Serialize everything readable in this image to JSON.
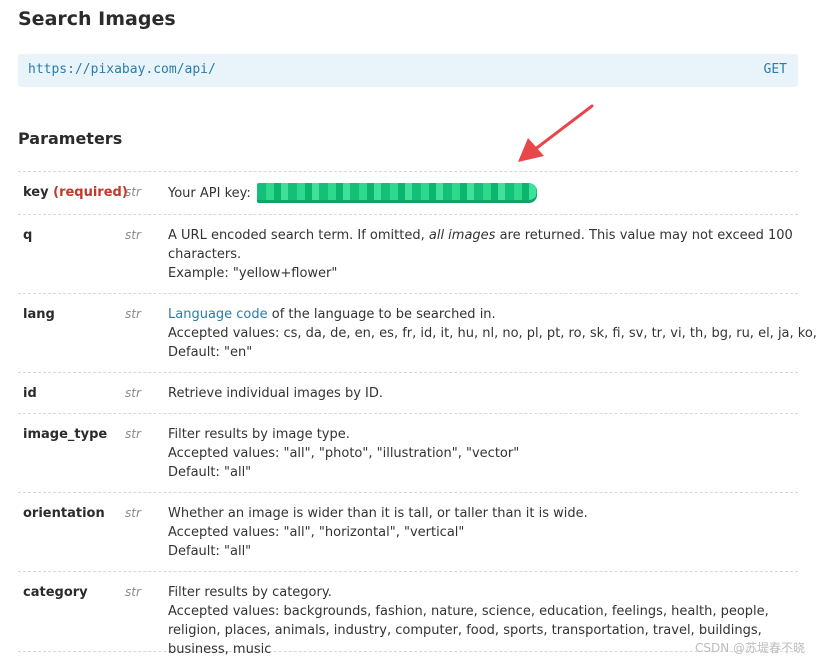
{
  "page": {
    "title": "Search Images"
  },
  "endpoint": {
    "url": "https://pixabay.com/api/",
    "method": "GET"
  },
  "parameters": {
    "heading": "Parameters",
    "rows": [
      {
        "name": "key",
        "required": "(required)",
        "type": "str",
        "desc": {
          "label": "Your API key:"
        }
      },
      {
        "name": "q",
        "type": "str",
        "desc": {
          "part1": "A URL encoded search term. If omitted, ",
          "emphasis": "all images",
          "part2": " are returned. This value may not exceed 100 characters.",
          "example": "Example: \"yellow+flower\""
        }
      },
      {
        "name": "lang",
        "type": "str",
        "desc": {
          "link": "Language code",
          "after_link": " of the language to be searched in.",
          "accepted": "Accepted values: cs, da, de, en, es, fr, id, it, hu, nl, no, pl, pt, ro, sk, fi, sv, tr, vi, th, bg, ru, el, ja, ko, zh",
          "default": "Default: \"en\""
        }
      },
      {
        "name": "id",
        "type": "str",
        "desc": {
          "text": "Retrieve individual images by ID."
        }
      },
      {
        "name": "image_type",
        "type": "str",
        "desc": {
          "text": "Filter results by image type.",
          "accepted": "Accepted values: \"all\", \"photo\", \"illustration\", \"vector\"",
          "default": "Default: \"all\""
        }
      },
      {
        "name": "orientation",
        "type": "str",
        "desc": {
          "text": "Whether an image is wider than it is tall, or taller than it is wide.",
          "accepted": "Accepted values: \"all\", \"horizontal\", \"vertical\"",
          "default": "Default: \"all\""
        }
      },
      {
        "name": "category",
        "type": "str",
        "desc": {
          "text": "Filter results by category.",
          "accepted": "Accepted values: backgrounds, fashion, nature, science, education, feelings, health, people, religion, places, animals, industry, computer, food, sports, transportation, travel, buildings, business, music"
        }
      }
    ]
  },
  "annotation": {
    "arrow_color": "#e8474a",
    "mask_color": "#12c07a"
  },
  "watermark": {
    "text": "CSDN @苏堤春不晓"
  }
}
